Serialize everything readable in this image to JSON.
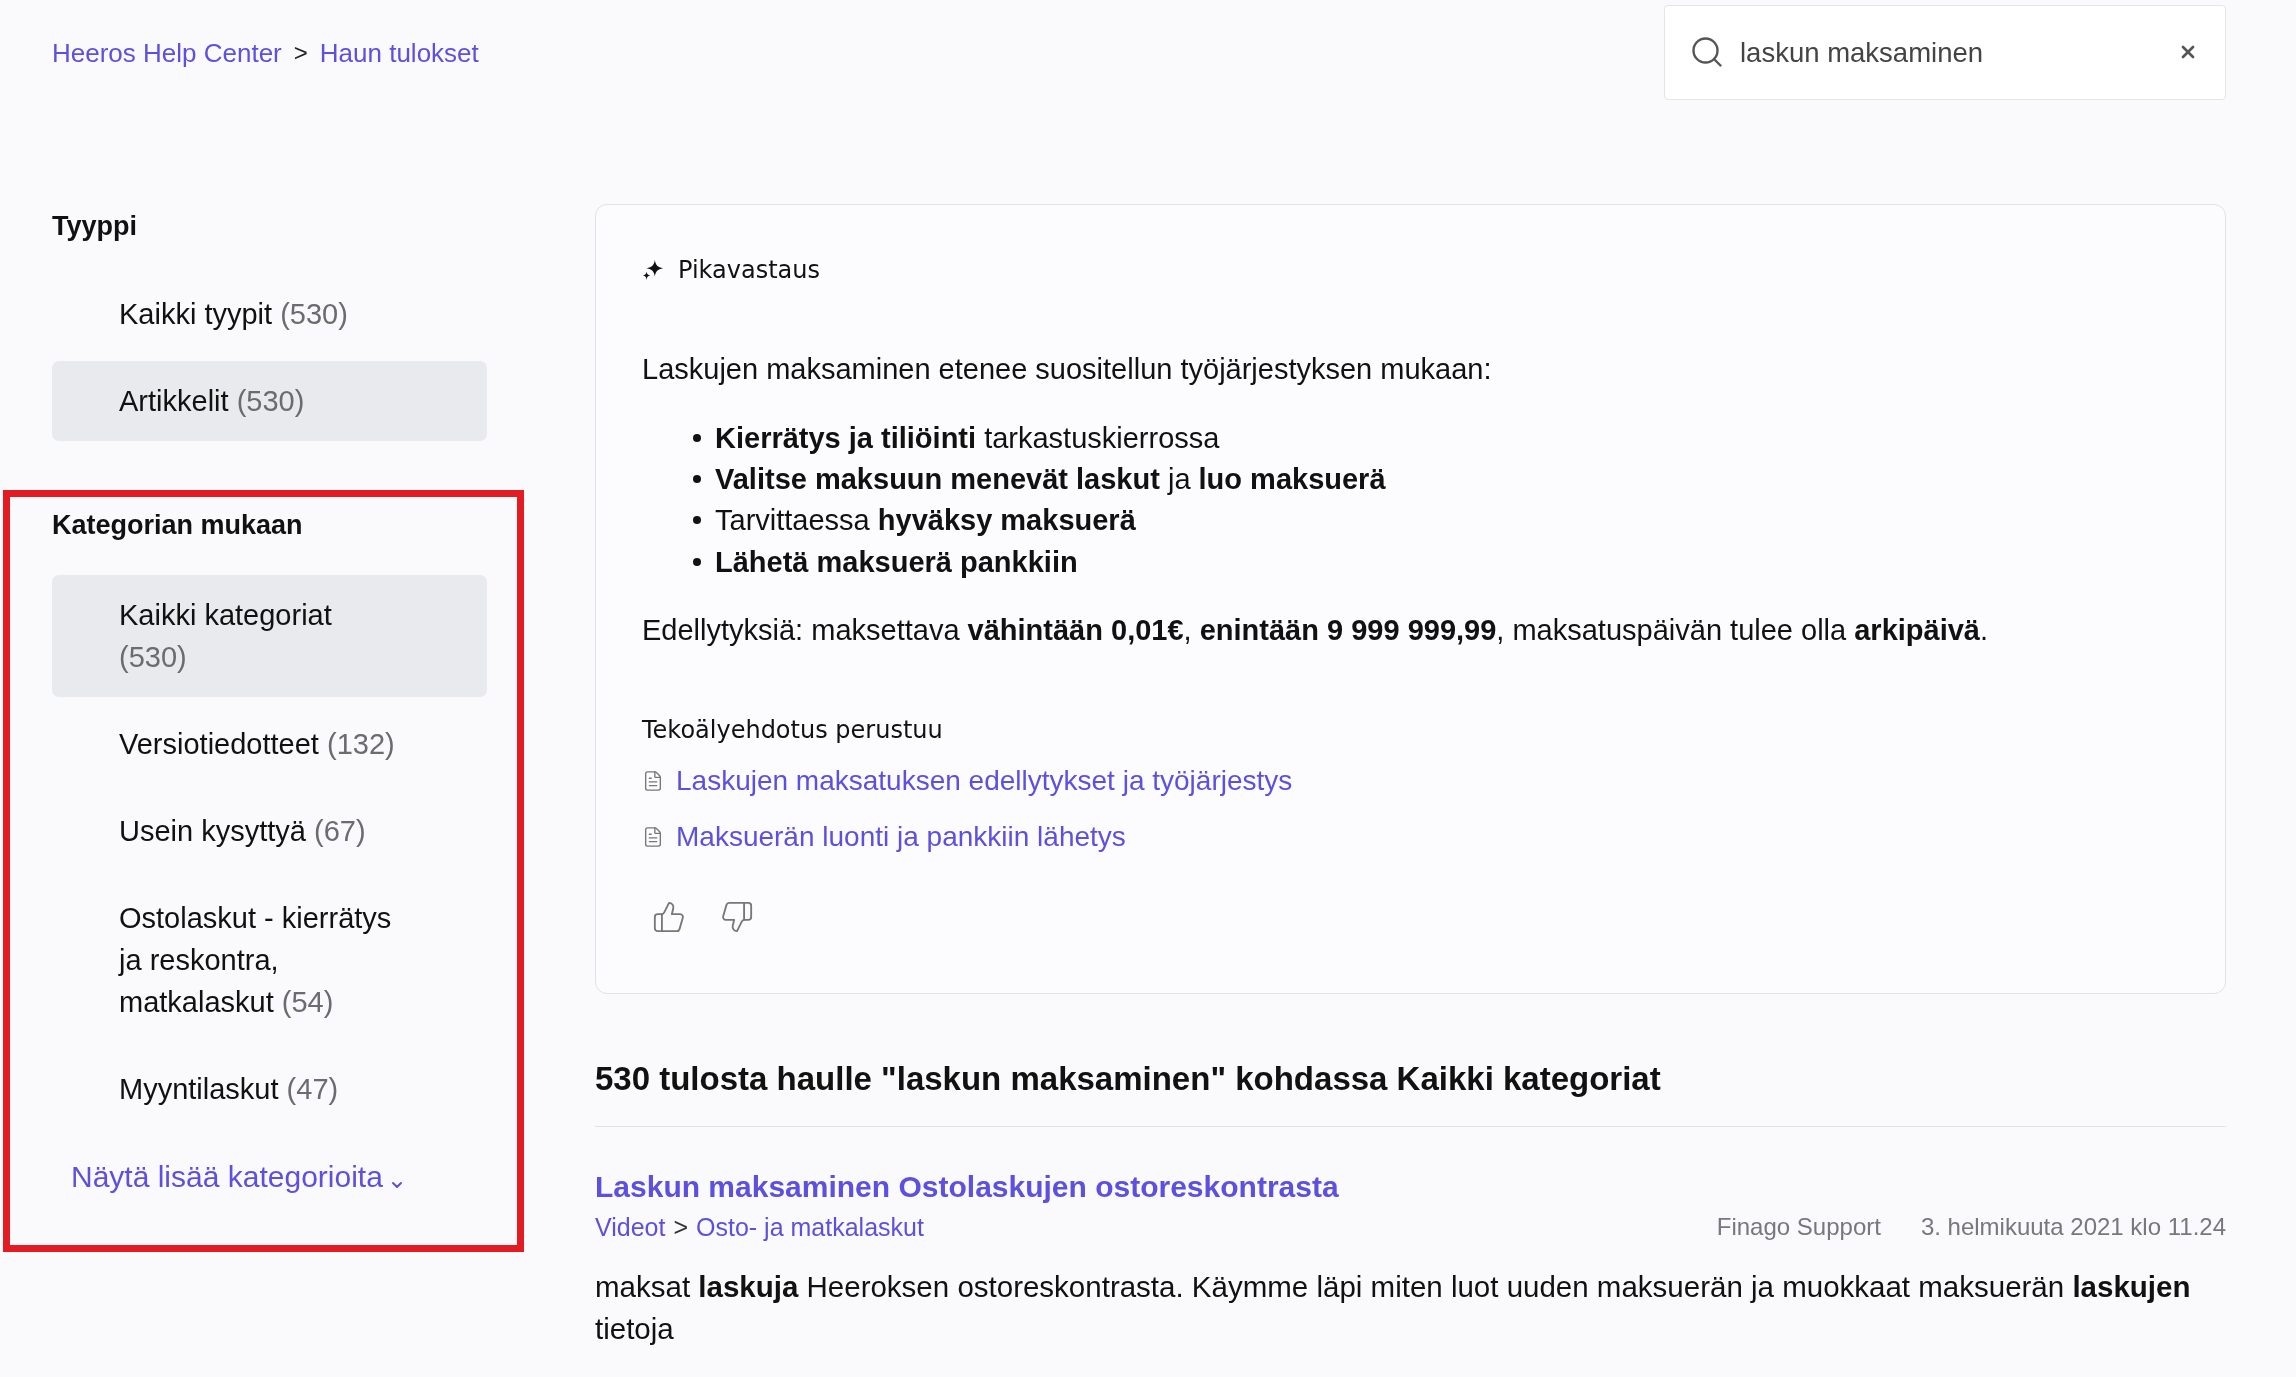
{
  "breadcrumb": {
    "separator": ">",
    "items": [
      {
        "label": "Heeros Help Center"
      },
      {
        "label": "Haun tulokset"
      }
    ]
  },
  "search": {
    "value": "laskun maksaminen"
  },
  "sidebar": {
    "sections": [
      {
        "title": "Tyyppi",
        "annotated": false,
        "items": [
          {
            "label": "Kaikki tyypit",
            "count": "(530)",
            "selected": false
          },
          {
            "label": "Artikkelit",
            "count": "(530)",
            "selected": true
          }
        ]
      },
      {
        "title": "Kategorian mukaan",
        "annotated": true,
        "items": [
          {
            "label": "Kaikki kategoriat",
            "count": "(530)",
            "selected": true
          },
          {
            "label": "Versiotiedotteet",
            "count": "(132)",
            "selected": false
          },
          {
            "label": "Usein kysyttyä",
            "count": "(67)",
            "selected": false
          },
          {
            "label": "Ostolaskut - kierrätys ja reskontra, matkalaskut",
            "count": "(54)",
            "selected": false
          },
          {
            "label": "Myyntilaskut",
            "count": "(47)",
            "selected": false
          }
        ],
        "more_link": "Näytä lisää kategorioita"
      }
    ]
  },
  "quick_answer": {
    "title": "Pikavastaus",
    "intro": "Laskujen maksaminen etenee suositellun työjärjestyksen mukaan:",
    "steps": [
      {
        "text": "**Kierrätys ja tiliöinti** tarkastuskierrossa",
        "bold": false
      },
      {
        "text": "**Valitse maksuun menevät laskut** ja **luo maksuerä**",
        "bold": false
      },
      {
        "text": "Tarvittaessa **hyväksy maksuerä**",
        "bold": false
      },
      {
        "text": "Lähetä maksuerä pankkiin",
        "bold": true
      }
    ],
    "conditions": "Edellytyksiä: maksettava **vähintään 0,01€**, **enintään 9 999 999,99**, maksatuspäivän tulee olla **arkipäivä**.",
    "sources_label": "Tekoälyehdotus perustuu",
    "sources": [
      {
        "label": "Laskujen maksatuksen edellytykset ja työjärjestys"
      },
      {
        "label": "Maksuerän luonti ja pankkiin lähetys"
      }
    ]
  },
  "results": {
    "heading": "530 tulosta haulle \"laskun maksaminen\" kohdassa Kaikki kategoriat",
    "items": [
      {
        "title": "Laskun maksaminen Ostolaskujen ostoreskontrasta",
        "path_separator": ">",
        "path": [
          {
            "label": "Videot"
          },
          {
            "label": "Osto- ja matkalaskut"
          }
        ],
        "author": "Finago Support",
        "date": "3. helmikuuta 2021 klo 11.24",
        "snippet": "maksat **laskuja** Heeroksen ostoreskontrasta. Käymme läpi miten luot uuden maksuerän ja muokkaat maksuerän **laskujen** tietoja"
      }
    ]
  }
}
